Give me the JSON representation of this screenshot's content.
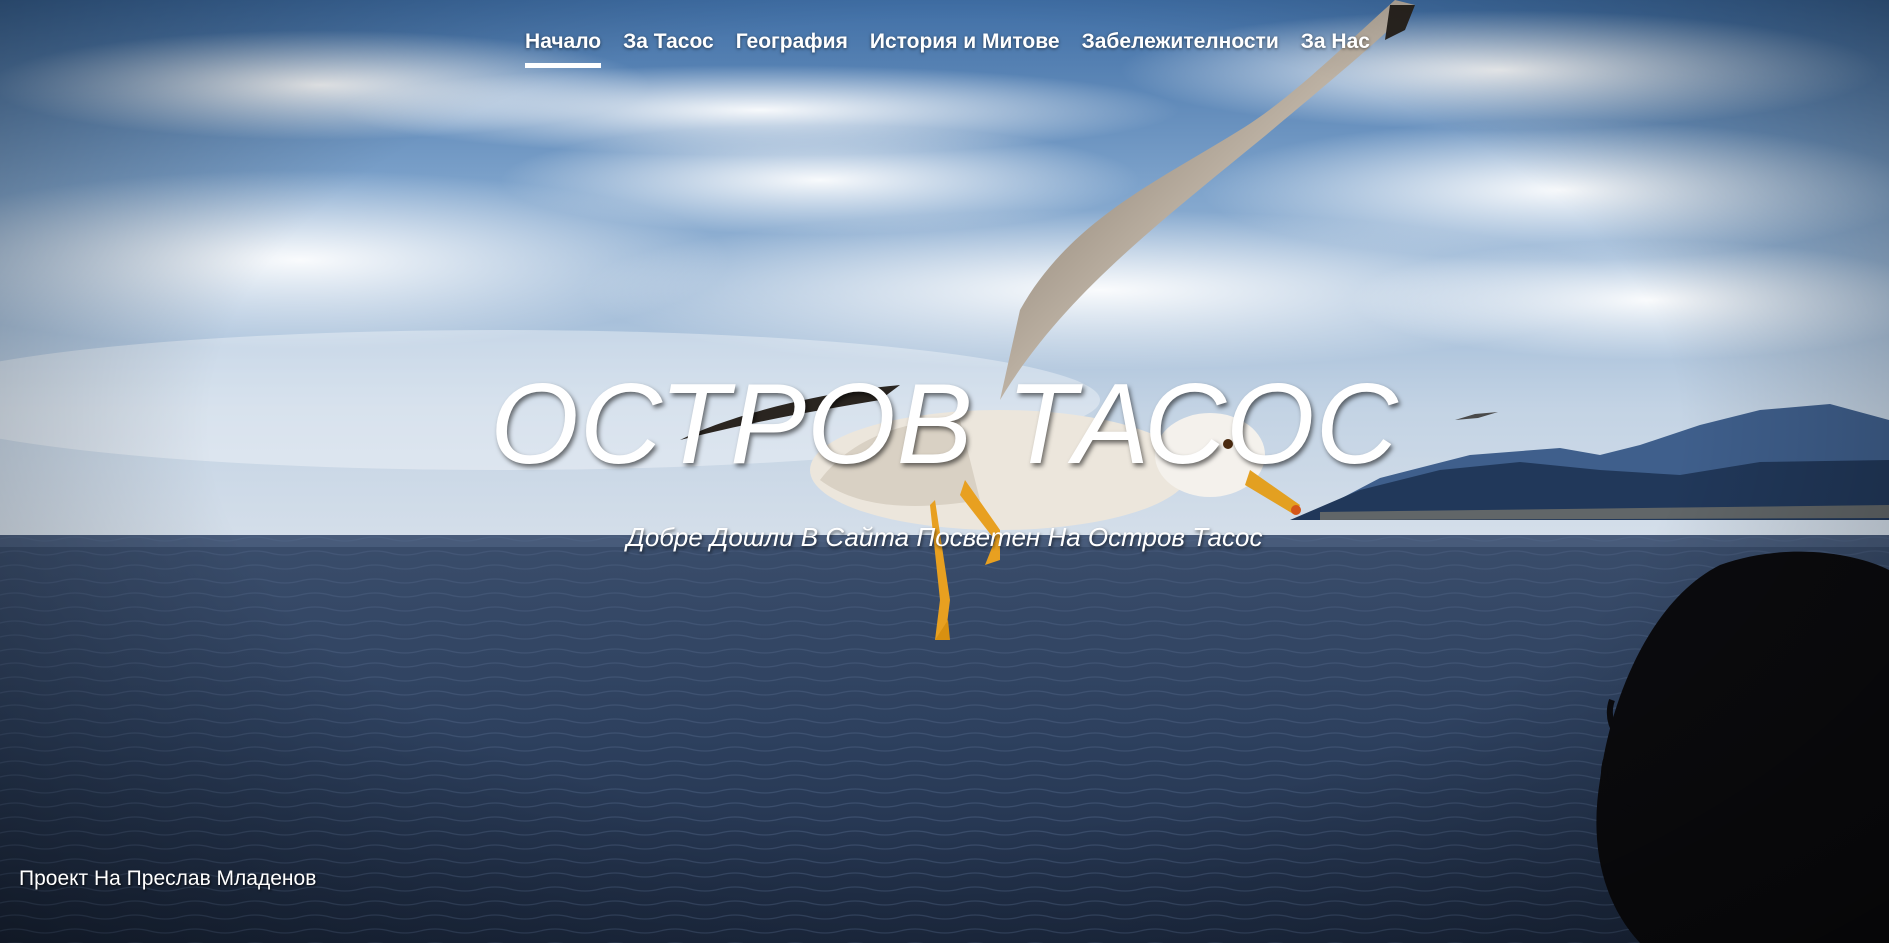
{
  "nav": {
    "items": [
      {
        "label": "Начало",
        "active": true
      },
      {
        "label": "За Тасос",
        "active": false
      },
      {
        "label": "География",
        "active": false
      },
      {
        "label": "История и Митове",
        "active": false
      },
      {
        "label": "Забележителности",
        "active": false
      },
      {
        "label": "За Нас",
        "active": false
      }
    ]
  },
  "hero": {
    "title": "ОСТРОВ ТАСОС",
    "subtitle": "Добре Дошли В Сайта Посветен На Остров Тасос",
    "background": "seagull-over-sea-photo"
  },
  "footer": {
    "credit": "Проект На Преслав Младенов"
  },
  "colors": {
    "sky_top": "#4f7fb5",
    "sky_bottom": "#c9d8e8",
    "sea": "#2c3e5a",
    "text": "#ffffff"
  }
}
